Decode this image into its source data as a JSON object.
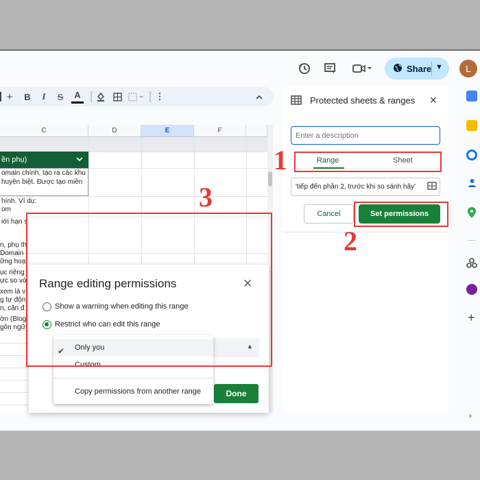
{
  "header": {
    "share_label": "Share",
    "avatar_letter": "L",
    "icons": [
      "history-icon",
      "comment-icon",
      "video-call-icon",
      "globe-icon"
    ]
  },
  "toolbar": {
    "add": "+",
    "bold": "B",
    "italic": "I",
    "strike": "S",
    "text_color": "A",
    "more": "⋮",
    "collapse": "⌃"
  },
  "sheet": {
    "columns": [
      "C",
      "D",
      "E",
      "F"
    ],
    "selected_column": "E",
    "header_cell": "ền phụ)",
    "cells": [
      "omain chính, tạo ra các khu",
      "huyên biệt. Được tạo miền",
      "hính. Ví dụ:",
      "om",
      "iới hạn s",
      "n, phụ thu",
      "Domain c",
      "ững hoạt",
      "ục riêng",
      "ực so với",
      "xem là v",
      "g tự độn",
      "n, căn đ",
      "ớn (Blog",
      "gôn ngữ"
    ]
  },
  "panel": {
    "title": "Protected sheets & ranges",
    "description_placeholder": "Enter a description",
    "tabs": [
      "Range",
      "Sheet"
    ],
    "active_tab": "Range",
    "range_value": "'tiếp đến phần 2, trước khi so sánh hãy'",
    "cancel_label": "Cancel",
    "set_permissions_label": "Set permissions"
  },
  "dialog": {
    "title": "Range editing permissions",
    "option_warning": "Show a warning when editing this range",
    "option_restrict": "Restrict who can edit this range",
    "selected_option": "restrict",
    "done_label": "Done",
    "menu_items": [
      "Only you",
      "Custom",
      "Copy permissions from another range"
    ],
    "menu_selected": "Only you"
  },
  "annotations": {
    "step1": "1",
    "step2": "2",
    "step3": "3"
  },
  "colors": {
    "accent_green": "#188038",
    "header_green": "#135e35",
    "share_blue": "#c2e7ff",
    "annotation_red": "#e53935",
    "selected_column_blue": "#d3e3fd"
  }
}
